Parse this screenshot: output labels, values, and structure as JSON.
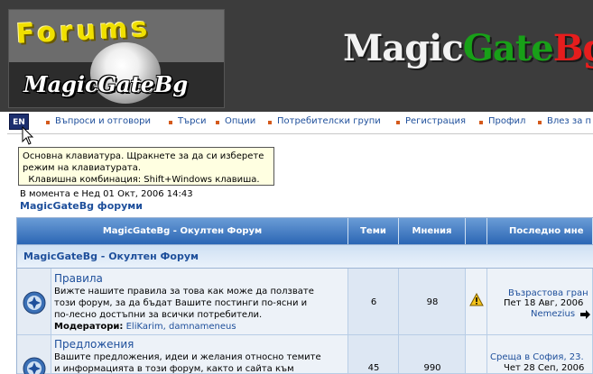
{
  "logo": {
    "forums_text": "Forums",
    "brand_text": "MagicGateBg"
  },
  "brand": {
    "part1": "Magic",
    "part2": "Gate",
    "part3": "Bg"
  },
  "language_indicator": "EN",
  "nav": [
    {
      "label": "Въпроси и отговори"
    },
    {
      "label": "Търси"
    },
    {
      "label": "Опции"
    },
    {
      "label": "Потребителски групи"
    },
    {
      "label": "Регистрация"
    },
    {
      "label": "Профил"
    },
    {
      "label": "Влез за п"
    }
  ],
  "tooltip": {
    "line1": "Основна клавиатура.  Щракнете за да си изберете",
    "line2": "режим на клавиатурата.",
    "line3": "  Клавишна комбинация: Shift+Windows клавиша."
  },
  "current_time": "В момента е Нед 01 Окт, 2006 14:43",
  "forum_index_link": "MagicGateBg форуми",
  "table": {
    "headers": {
      "forum": "MagicGateBg - Окултен Форум",
      "topics": "Теми",
      "posts": "Мнения",
      "last_post": "Последно мне"
    },
    "category": "MagicGateBg - Окултен Форум",
    "rows": [
      {
        "title": "Правила",
        "desc1": "Вижте нашите правила за това как може да ползвате",
        "desc2": "този форум, за да бъдат Вашите постинги по-ясни и",
        "desc3": "по-лесно достъпни за всички потребители.",
        "mod_label": "Модератори:",
        "mod_names": "EliKarim, damnameneus",
        "topics": "6",
        "posts": "98",
        "last_title": "Възрастова гран",
        "last_date": "Пет 18 Авг, 2006",
        "last_user": "Nemezius"
      },
      {
        "title": "Предложения",
        "desc1": "Вашите предложения, идеи и желания относно темите",
        "desc2": "и информацията в този форум, както и сайта към",
        "topics": "45",
        "posts": "990",
        "last_title": "Среща в София, 23.",
        "last_date": "Чет 28 Сеп, 2006"
      }
    ]
  }
}
